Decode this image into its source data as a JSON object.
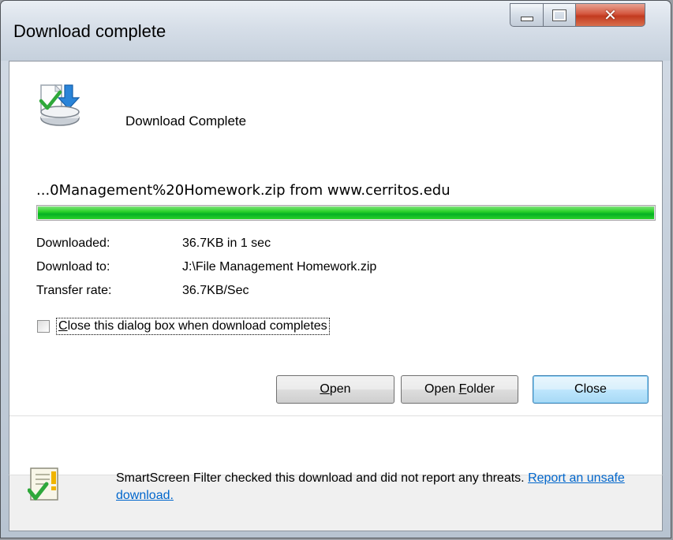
{
  "window": {
    "title": "Download complete",
    "controls": {
      "minimize": "minimize",
      "maximize": "maximize",
      "close": "close"
    }
  },
  "header": {
    "icon": "download-complete-icon",
    "text": "Download Complete"
  },
  "download": {
    "filename": "...0Management%20Homework.zip from www.cerritos.edu",
    "progress_percent": 100,
    "details": [
      {
        "label": "Downloaded:",
        "value": "36.7KB in 1 sec"
      },
      {
        "label": "Download to:",
        "value": "J:\\File Management Homework.zip"
      },
      {
        "label": "Transfer rate:",
        "value": "36.7KB/Sec"
      }
    ]
  },
  "options": {
    "close_on_complete_prefix": "C",
    "close_on_complete_rest": "lose this dialog box when download completes",
    "close_on_complete_checked": false
  },
  "buttons": {
    "open_mnemonic": "O",
    "open_rest": "pen",
    "folder_prefix": "Open ",
    "folder_mnemonic": "F",
    "folder_rest": "older",
    "close": "Close"
  },
  "smartscreen": {
    "icon": "smartscreen-check-icon",
    "text": "SmartScreen Filter checked this download and did not report any threats. ",
    "link": "Report an unsafe download."
  },
  "colors": {
    "progress": "#06b025",
    "link": "#0066cc",
    "close_button": "#c23a1f"
  }
}
